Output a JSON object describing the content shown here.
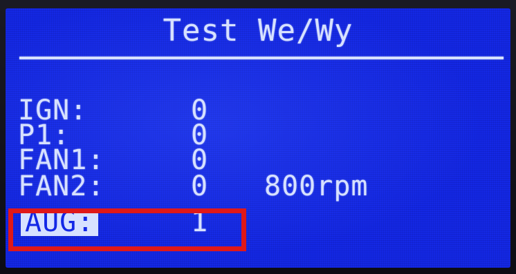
{
  "screen": {
    "title": "Test We/Wy"
  },
  "rows": [
    {
      "label": "IGN:",
      "value": "0",
      "extra": ""
    },
    {
      "label": "P1:",
      "value": "0",
      "extra": ""
    },
    {
      "label": "FAN1:",
      "value": "0",
      "extra": ""
    },
    {
      "label": "FAN2:",
      "value": "0",
      "extra": "800rpm"
    },
    {
      "label": "AUG:",
      "value": "1",
      "extra": ""
    }
  ],
  "colors": {
    "lcd_background": "#1428e6",
    "lcd_text": "#d7e1ff",
    "annotation_box": "#e01818"
  }
}
